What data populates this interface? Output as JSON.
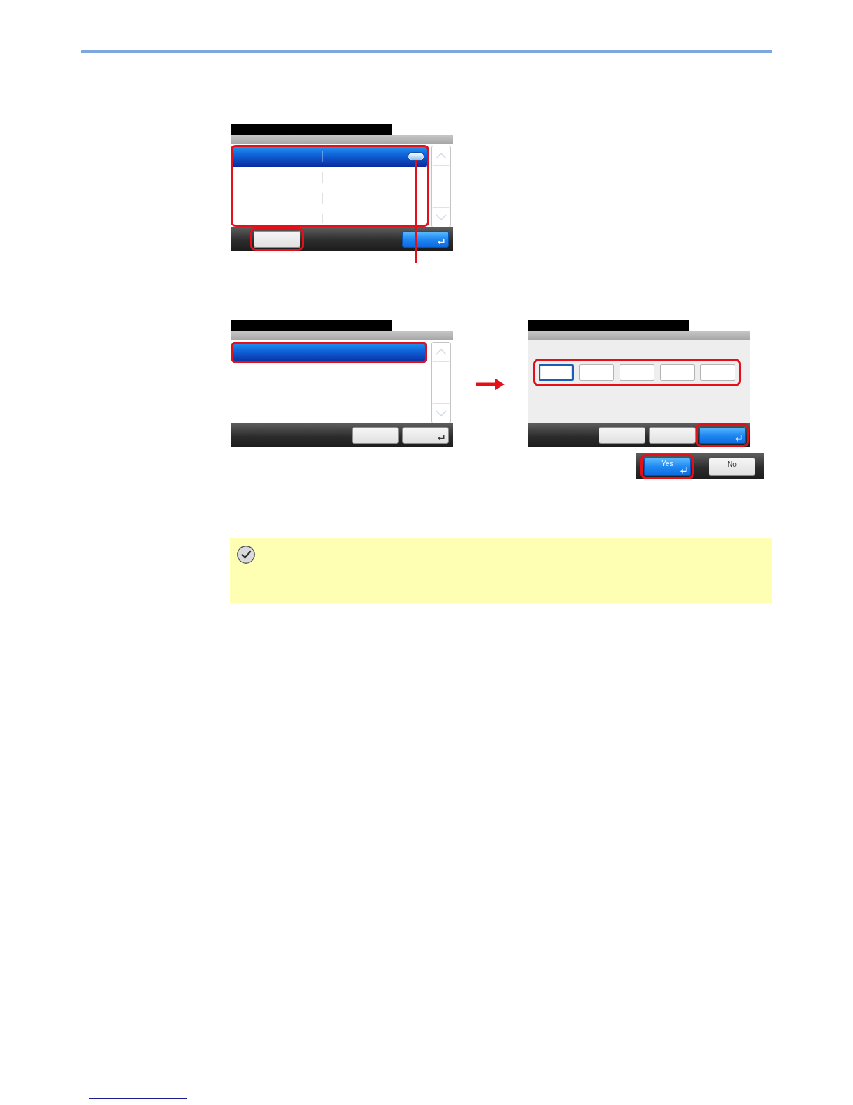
{
  "figures": [
    {
      "screens": [
        {
          "kind": "list",
          "list": {
            "kind": "two-column",
            "highlighted": true,
            "rows": [
              {
                "selected": true,
                "detail_button": {
                  "callout": true
                }
              },
              {
                "selected": false
              },
              {
                "selected": false
              },
              {
                "selected": false
              }
            ]
          },
          "scrollbar": {
            "up": {
              "disabled": true
            },
            "down": {
              "disabled": true
            }
          },
          "footer": {
            "left": [
              {
                "kind": "plain",
                "primary": false,
                "highlighted": true
              }
            ],
            "right": [
              {
                "kind": "enter",
                "primary": true,
                "highlighted": false
              }
            ]
          }
        }
      ]
    },
    {
      "arrow": true,
      "screens": [
        {
          "kind": "list",
          "list": {
            "kind": "one-column",
            "rows": [
              {
                "selected": true,
                "highlighted": true
              },
              {
                "selected": false,
                "highlighted": false
              },
              {
                "selected": false,
                "highlighted": false
              },
              {
                "selected": false,
                "highlighted": false
              }
            ]
          },
          "scrollbar": {
            "up": {
              "disabled": true
            },
            "down": {
              "disabled": true
            }
          },
          "footer": {
            "right": [
              {
                "kind": "plain",
                "primary": false,
                "highlighted": false
              },
              {
                "kind": "enter",
                "primary": false,
                "highlighted": false
              }
            ]
          }
        },
        {
          "kind": "address-entry",
          "fields": {
            "highlighted": true,
            "items": [
              {
                "selected": true
              },
              {
                "selected": false
              },
              {
                "selected": false
              },
              {
                "selected": false
              },
              {
                "selected": false
              }
            ],
            "separators": [
              "-",
              "-",
              "-",
              "-"
            ]
          },
          "footer": {
            "right": [
              {
                "kind": "plain",
                "primary": false,
                "highlighted": false
              },
              {
                "kind": "plain",
                "primary": false,
                "highlighted": false
              },
              {
                "kind": "enter",
                "primary": true,
                "highlighted": true
              }
            ]
          },
          "confirm": {
            "buttons": [
              {
                "kind": "enter",
                "primary": true,
                "highlighted": true,
                "label": "Yes"
              },
              {
                "kind": "plain",
                "primary": false,
                "highlighted": false,
                "label": "No"
              }
            ]
          }
        }
      ]
    }
  ],
  "note": {
    "kind": "check"
  }
}
